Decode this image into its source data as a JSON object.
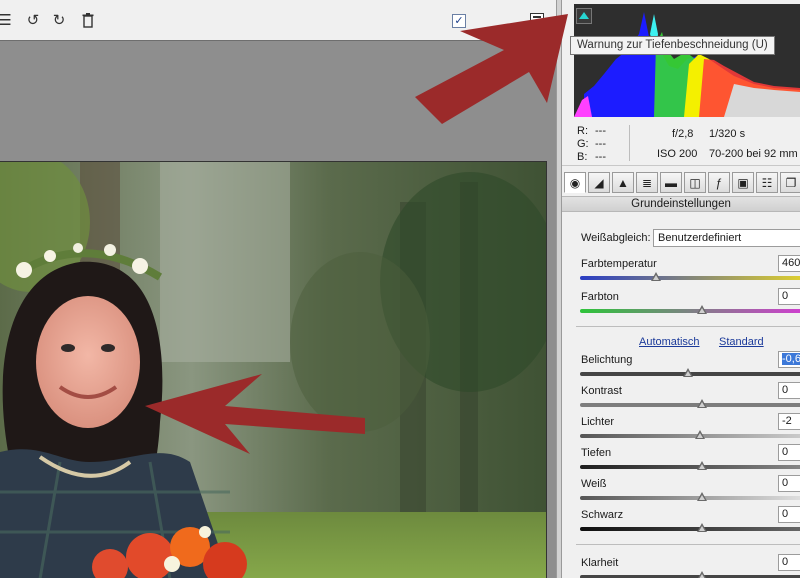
{
  "toolbar": {
    "icons": [
      "list-icon",
      "rotate-left-icon",
      "rotate-right-icon",
      "trash-icon"
    ],
    "checkbox_checked": true
  },
  "histogram": {
    "tooltip": "Warnung zur Tiefenbeschneidung (U)"
  },
  "info": {
    "r_label": "R:",
    "r_value": "---",
    "g_label": "G:",
    "g_value": "---",
    "b_label": "B:",
    "b_value": "---",
    "aperture": "f/2,8",
    "shutter": "1/320 s",
    "iso": "ISO 200",
    "lens": "70-200 bei 92 mm"
  },
  "panel": {
    "section_title": "Grundeinstellungen",
    "white_balance_label": "Weißabgleich:",
    "white_balance_value": "Benutzerdefiniert",
    "auto_link": "Automatisch",
    "default_link": "Standard",
    "sliders": [
      {
        "label": "Farbtemperatur",
        "value": "460",
        "position": 0.33
      },
      {
        "label": "Farbton",
        "value": "0",
        "position": 0.53
      },
      {
        "label": "Belichtung",
        "value": "-0,6",
        "position": 0.47
      },
      {
        "label": "Kontrast",
        "value": "0",
        "position": 0.53
      },
      {
        "label": "Lichter",
        "value": "-2",
        "position": 0.52
      },
      {
        "label": "Tiefen",
        "value": "0",
        "position": 0.53
      },
      {
        "label": "Weiß",
        "value": "0",
        "position": 0.53
      },
      {
        "label": "Schwarz",
        "value": "0",
        "position": 0.53
      },
      {
        "label": "Klarheit",
        "value": "0",
        "position": 0.53
      }
    ]
  },
  "colors": {
    "arrow": "#9b2a2a",
    "clip_warning": "#27d6d2",
    "link": "#1b3a9a"
  }
}
